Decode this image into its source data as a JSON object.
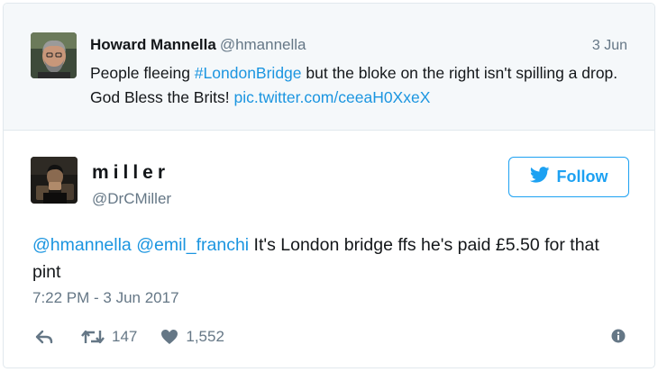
{
  "parent_tweet": {
    "author_name": "Howard Mannella",
    "author_handle": "@hmannella",
    "date": "3 Jun",
    "text_before_hashtag": "People fleeing ",
    "hashtag": "#LondonBridge",
    "text_after_hashtag": " but the bloke on the right isn't spilling a drop. God Bless the Brits! ",
    "pic_link": "pic.twitter.com/ceeaH0XxeX"
  },
  "tweet": {
    "author_name": "miller",
    "author_handle": "@DrCMiller",
    "follow_label": "Follow",
    "mention_1": "@hmannella",
    "mention_2": "@emil_franchi",
    "text": " It's London bridge ffs he's paid £5.50 for that pint",
    "timestamp": "7:22 PM - 3 Jun 2017",
    "retweet_count": "147",
    "like_count": "1,552"
  },
  "icons": {
    "reply": "reply-icon",
    "retweet": "retweet-icon",
    "like": "heart-icon",
    "info": "info-icon",
    "follow": "twitter-bird-icon"
  },
  "colors": {
    "link": "#1b95e0",
    "twitter_blue": "#1da1f2",
    "muted": "#657786",
    "parent_bg": "#f5f8fa"
  }
}
